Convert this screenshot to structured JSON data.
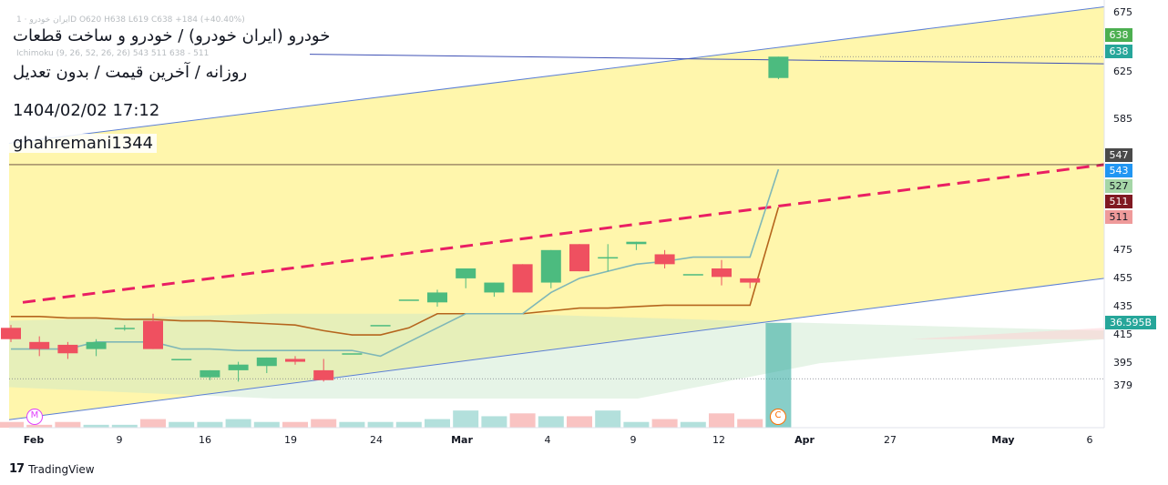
{
  "header": {
    "symbol_title": "خودرو (ایران خودرو) / خودرو و ساخت قطعات",
    "subtitle": "روزانه / آخرین قیمت / بدون تعدیل",
    "timestamp": "1404/02/02 17:12",
    "author": "ghahremani1344",
    "faint_legend_1": "ایران خودرو · 1D  O620  H638  L619  C638  +184 (+40.40%)",
    "faint_legend_2": "Ichimoku (9, 26, 52, 26, 26)  543  511  638  -  511"
  },
  "price_axis": {
    "ticks": [
      "675",
      "625",
      "585",
      "475",
      "455",
      "435",
      "415",
      "395",
      "379"
    ],
    "tags": [
      {
        "label": "638",
        "color": "#4caf50",
        "value": 638
      },
      {
        "label": "638",
        "color": "#26a69a",
        "value": 638
      },
      {
        "label": "547",
        "color": "#4a4a4a",
        "value": 547
      },
      {
        "label": "543",
        "color": "#2196f3",
        "value": 543
      },
      {
        "label": "527",
        "color": "#a5d6a7",
        "value": 527
      },
      {
        "label": "511",
        "color": "#801922",
        "value": 511
      },
      {
        "label": "511",
        "color": "#ef9a9a",
        "value": 511
      },
      {
        "label": "36.595B",
        "color": "#26a69a",
        "value": 424
      }
    ]
  },
  "time_axis": {
    "ticks": [
      "Feb",
      "9",
      "16",
      "19",
      "24",
      "Mar",
      "4",
      "9",
      "12",
      "Apr",
      "27",
      "May",
      "6"
    ]
  },
  "events": [
    {
      "symbol": "M",
      "color": "#e040fb"
    },
    {
      "symbol": "C",
      "color": "#ff6d00"
    }
  ],
  "footer": {
    "brand": "TradingView",
    "logo": "17"
  },
  "chart_data": {
    "type": "candlestick",
    "x_label": "",
    "y_label": "",
    "y_range": [
      370,
      680
    ],
    "candles": [
      {
        "o": 420,
        "h": 422,
        "l": 410,
        "c": 412
      },
      {
        "o": 410,
        "h": 414,
        "l": 400,
        "c": 405
      },
      {
        "o": 408,
        "h": 410,
        "l": 398,
        "c": 402
      },
      {
        "o": 405,
        "h": 412,
        "l": 400,
        "c": 410
      },
      {
        "o": 420,
        "h": 422,
        "l": 418,
        "c": 420
      },
      {
        "o": 425,
        "h": 430,
        "l": 405,
        "c": 405
      },
      {
        "o": 398,
        "h": 398,
        "l": 398,
        "c": 398
      },
      {
        "o": 385,
        "h": 390,
        "l": 383,
        "c": 390
      },
      {
        "o": 390,
        "h": 396,
        "l": 382,
        "c": 394
      },
      {
        "o": 393,
        "h": 399,
        "l": 388,
        "c": 399
      },
      {
        "o": 398,
        "h": 400,
        "l": 394,
        "c": 396
      },
      {
        "o": 390,
        "h": 398,
        "l": 382,
        "c": 383
      },
      {
        "o": 402,
        "h": 402,
        "l": 402,
        "c": 402
      },
      {
        "o": 422,
        "h": 422,
        "l": 422,
        "c": 422
      },
      {
        "o": 440,
        "h": 440,
        "l": 440,
        "c": 440
      },
      {
        "o": 438,
        "h": 447,
        "l": 435,
        "c": 445
      },
      {
        "o": 455,
        "h": 460,
        "l": 448,
        "c": 462
      },
      {
        "o": 445,
        "h": 452,
        "l": 442,
        "c": 452
      },
      {
        "o": 465,
        "h": 465,
        "l": 445,
        "c": 445
      },
      {
        "o": 452,
        "h": 475,
        "l": 448,
        "c": 475
      },
      {
        "o": 480,
        "h": 480,
        "l": 460,
        "c": 460
      },
      {
        "o": 470,
        "h": 480,
        "l": 460,
        "c": 470
      },
      {
        "o": 480,
        "h": 482,
        "l": 475,
        "c": 482
      },
      {
        "o": 472,
        "h": 475,
        "l": 462,
        "c": 465
      },
      {
        "o": 458,
        "h": 458,
        "l": 458,
        "c": 458
      },
      {
        "o": 462,
        "h": 468,
        "l": 450,
        "c": 456
      },
      {
        "o": 455,
        "h": 455,
        "l": 448,
        "c": 452
      },
      {
        "o": 620,
        "h": 638,
        "l": 619,
        "c": 638
      }
    ],
    "tenkan": [
      405,
      405,
      405,
      410,
      410,
      410,
      405,
      405,
      404,
      404,
      404,
      404,
      404,
      400,
      410,
      420,
      430,
      430,
      430,
      445,
      455,
      460,
      465,
      467,
      470,
      470,
      470,
      543
    ],
    "kijun": [
      428,
      428,
      427,
      427,
      426,
      426,
      425,
      425,
      424,
      423,
      422,
      418,
      415,
      415,
      420,
      430,
      430,
      430,
      430,
      432,
      434,
      434,
      435,
      436,
      436,
      436,
      436,
      511
    ],
    "channel": {
      "upper_start": 565,
      "upper_end": 680,
      "lower_start": 355,
      "lower_end": 455,
      "mid_start": 438,
      "mid_end": 547
    },
    "horizontal_line": 547,
    "volume": [
      2,
      1,
      2,
      1,
      1,
      3,
      2,
      2,
      3,
      2,
      2,
      3,
      2,
      2,
      2,
      3,
      6,
      4,
      5,
      4,
      4,
      6,
      2,
      3,
      2,
      5,
      3,
      36.595
    ]
  }
}
